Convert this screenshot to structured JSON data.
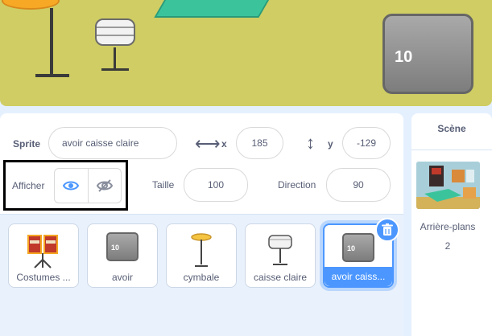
{
  "stage": {
    "sprite_label": "10"
  },
  "sprite_info": {
    "sprite_label": "Sprite",
    "sprite_name": "avoir caisse claire",
    "x_label": "x",
    "x_value": "185",
    "y_label": "y",
    "y_value": "-129",
    "show_label": "Afficher",
    "size_label": "Taille",
    "size_value": "100",
    "direction_label": "Direction",
    "direction_value": "90"
  },
  "sprite_list": {
    "items": [
      {
        "label": "Costumes ..."
      },
      {
        "label": "avoir",
        "thumb_text": "10"
      },
      {
        "label": "cymbale"
      },
      {
        "label": "caisse claire"
      },
      {
        "label": "avoir caiss...",
        "thumb_text": "10"
      }
    ]
  },
  "stage_panel": {
    "title": "Scène",
    "backdrops_label": "Arrière-plans",
    "backdrops_count": "2"
  },
  "colors": {
    "accent": "#4c97ff",
    "stage_bg": "#cfcd63",
    "panel_bg": "#e5f0ff"
  }
}
